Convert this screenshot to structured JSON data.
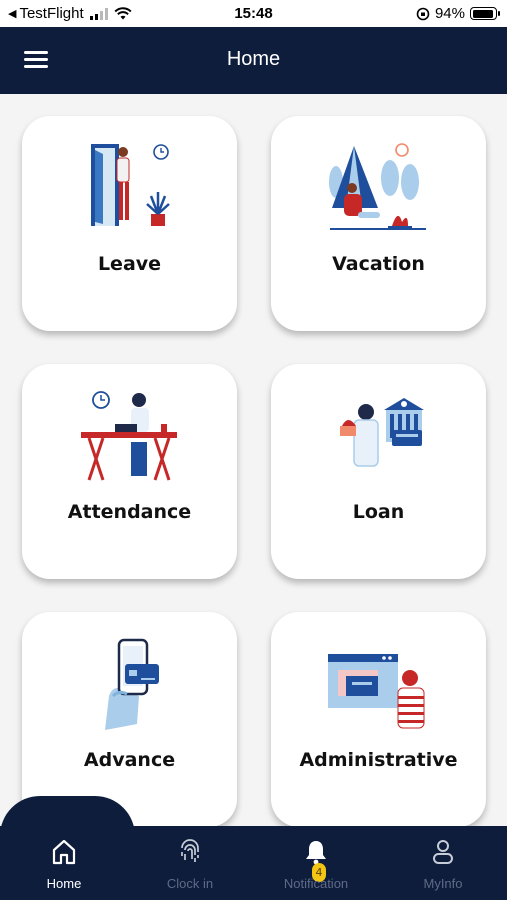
{
  "status_bar": {
    "back_app": "TestFlight",
    "time": "15:48",
    "battery": "94%",
    "battery_level": 0.94
  },
  "header": {
    "title": "Home",
    "menu_icon": "hamburger-menu-icon"
  },
  "cards": [
    {
      "label": "Leave",
      "icon": "door-person-illustration"
    },
    {
      "label": "Vacation",
      "icon": "camping-tent-illustration"
    },
    {
      "label": "Attendance",
      "icon": "desk-worker-illustration"
    },
    {
      "label": "Loan",
      "icon": "bank-money-illustration"
    },
    {
      "label": "Advance",
      "icon": "phone-card-illustration"
    },
    {
      "label": "Administrative",
      "icon": "presenter-screen-illustration"
    }
  ],
  "bottom_nav": {
    "items": [
      {
        "label": "Home",
        "icon": "home-icon",
        "active": true
      },
      {
        "label": "Clock in",
        "icon": "fingerprint-icon",
        "active": false
      },
      {
        "label": "Notification",
        "icon": "bell-icon",
        "active": false,
        "badge": "4"
      },
      {
        "label": "MyInfo",
        "icon": "user-icon",
        "active": false
      }
    ]
  },
  "colors": {
    "navy": "#0f1d3d",
    "accent_blue": "#1f4f9c",
    "light_blue": "#a9cdea",
    "red": "#c62828",
    "badge": "#f3c515"
  }
}
